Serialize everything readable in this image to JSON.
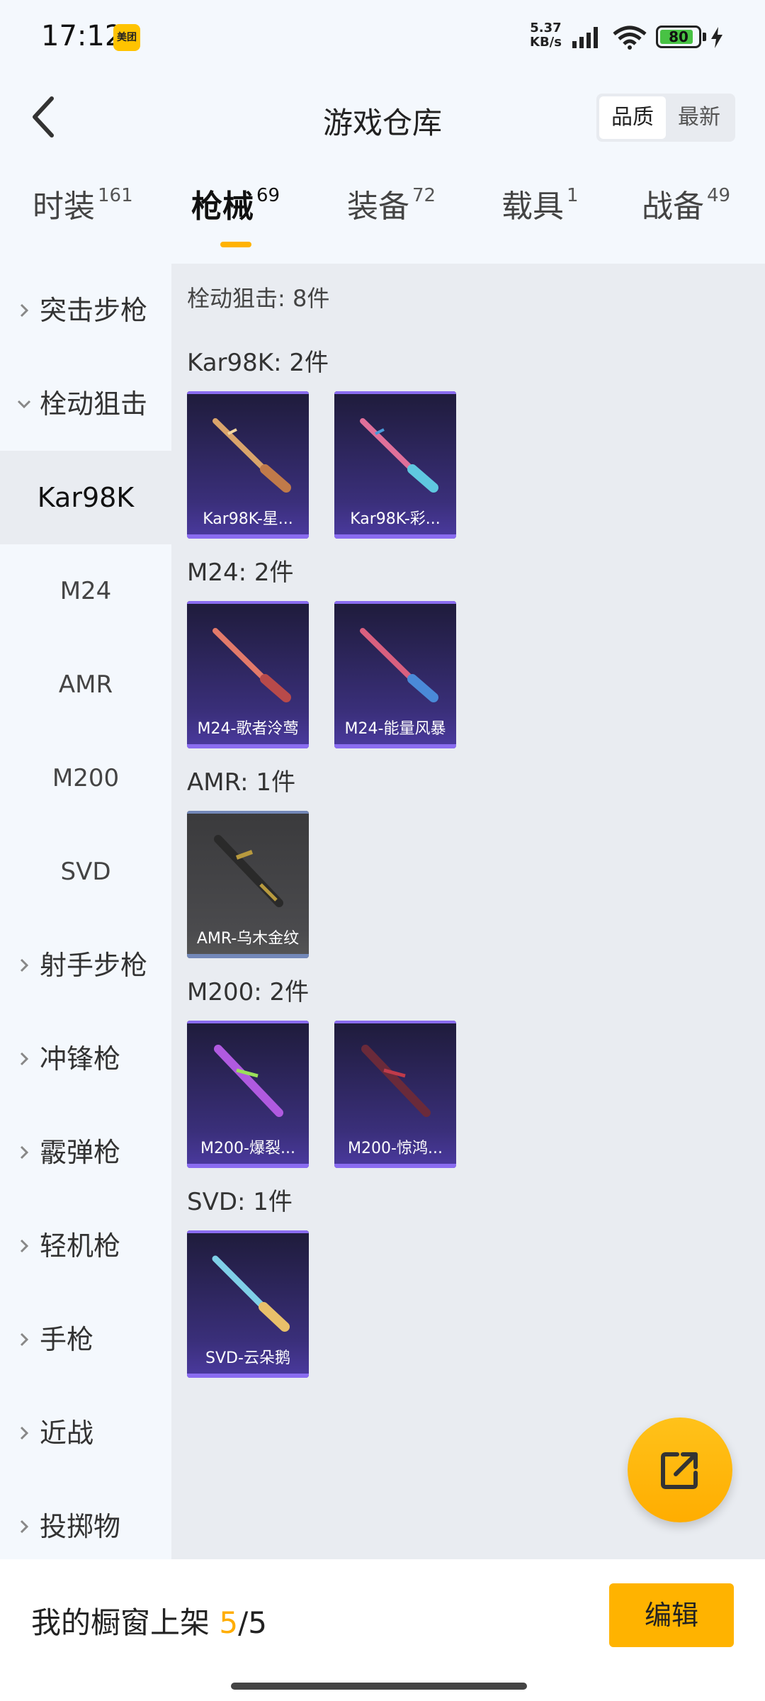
{
  "status_bar": {
    "time": "17:12",
    "app_badge": "美团",
    "net_speed": "5.37",
    "net_unit": "KB/s",
    "battery": "80"
  },
  "header": {
    "title": "游戏仓库",
    "sort_options": [
      "品质",
      "最新"
    ],
    "active_sort": "品质"
  },
  "tabs": [
    {
      "label": "时装",
      "count": "161"
    },
    {
      "label": "枪械",
      "count": "69"
    },
    {
      "label": "装备",
      "count": "72"
    },
    {
      "label": "载具",
      "count": "1"
    },
    {
      "label": "战备",
      "count": "49"
    }
  ],
  "active_tab": "枪械",
  "sidebar": {
    "categories_top": [
      {
        "label": "突击步枪",
        "expanded": false
      },
      {
        "label": "栓动狙击",
        "expanded": true
      }
    ],
    "subitems": [
      "Kar98K",
      "M24",
      "AMR",
      "M200",
      "SVD"
    ],
    "active_subitem": "Kar98K",
    "categories_bottom": [
      {
        "label": "射手步枪"
      },
      {
        "label": "冲锋枪"
      },
      {
        "label": "霰弹枪"
      },
      {
        "label": "轻机枪"
      },
      {
        "label": "手枪"
      },
      {
        "label": "近战"
      },
      {
        "label": "投掷物"
      }
    ]
  },
  "content": {
    "summary": "栓动狙击: 8件",
    "groups": [
      {
        "title": "Kar98K: 2件",
        "items": [
          {
            "name": "Kar98K-星...",
            "color": "#d9a46b",
            "style": "purple"
          },
          {
            "name": "Kar98K-彩...",
            "color": "#e0709a",
            "style": "purple"
          }
        ]
      },
      {
        "title": "M24: 2件",
        "items": [
          {
            "name": "M24-歌者泠莺",
            "color": "#e27a6a",
            "style": "purple"
          },
          {
            "name": "M24-能量风暴",
            "color": "#d9607f",
            "style": "purple"
          }
        ]
      },
      {
        "title": "AMR: 1件",
        "items": [
          {
            "name": "AMR-乌木金纹",
            "color": "#b89a3e",
            "style": "gray"
          }
        ]
      },
      {
        "title": "M200: 2件",
        "items": [
          {
            "name": "M200-爆裂...",
            "color": "#b05ae0",
            "style": "purple"
          },
          {
            "name": "M200-惊鸿...",
            "color": "#6a2a3a",
            "style": "purple"
          }
        ]
      },
      {
        "title": "SVD: 1件",
        "items": [
          {
            "name": "SVD-云朵鹅",
            "color": "#7fd0e8",
            "style": "purple"
          }
        ]
      }
    ]
  },
  "bottom": {
    "showcase_label": "我的橱窗上架",
    "showcase_current": "5",
    "showcase_total": "/5",
    "edit_label": "编辑"
  },
  "icons": {
    "back": "back-arrow-icon",
    "share": "share-icon",
    "chevron": "chevron-right-icon"
  }
}
